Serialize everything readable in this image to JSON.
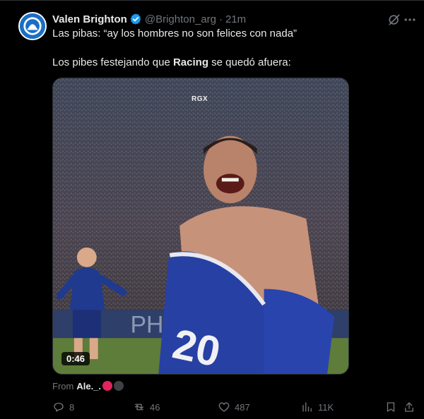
{
  "author": {
    "name": "Valen Brighton",
    "handle": "@Brighton_arg",
    "time": "21m"
  },
  "tweet": {
    "line1": "Las pibas: “ay los hombres no son felices con nada”",
    "line2_before": "Los pibes festejando que ",
    "line2_bold": "Racing",
    "line2_after": " se quedó afuera:"
  },
  "media": {
    "watermark": "RGX",
    "duration": "0:46"
  },
  "attribution": {
    "from_label": "From",
    "user": "Ale._."
  },
  "actions": {
    "replies": "8",
    "reposts": "46",
    "likes": "487",
    "views": "11K"
  },
  "colors": {
    "background": "#000000",
    "text": "#e7e9ea",
    "muted": "#71767b",
    "verified": "#1d9bf0",
    "badge_red": "#e0245e",
    "badge_gray": "#3e4144"
  },
  "icons": [
    "avatar-logo",
    "verified-icon",
    "grok-icon",
    "more-icon",
    "reply-icon",
    "repost-icon",
    "like-icon",
    "views-icon",
    "bookmark-icon",
    "share-icon"
  ]
}
